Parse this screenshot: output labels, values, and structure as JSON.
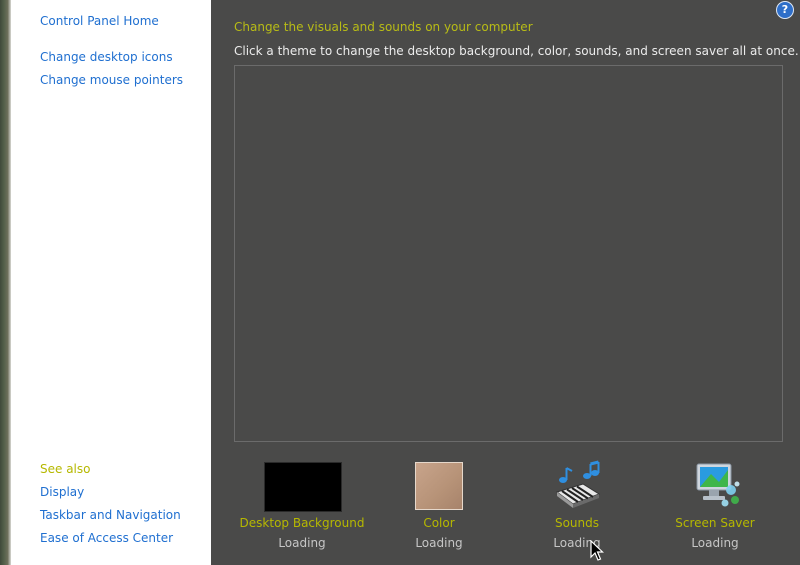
{
  "sidebar": {
    "tasks": [
      {
        "label": "Control Panel Home"
      },
      {
        "label": "Change desktop icons"
      },
      {
        "label": "Change mouse pointers"
      }
    ],
    "see_also_title": "See also",
    "see_also": [
      {
        "label": "Display"
      },
      {
        "label": "Taskbar and Navigation"
      },
      {
        "label": "Ease of Access Center"
      }
    ]
  },
  "main": {
    "help_glyph": "?",
    "headline": "Change the visuals and sounds on your computer",
    "subtitle": "Click a theme to change the desktop background, color, sounds, and screen saver all at once.",
    "tiles": [
      {
        "label": "Desktop Background",
        "status": "Loading",
        "icon": "black-swatch"
      },
      {
        "label": "Color",
        "status": "Loading",
        "icon": "tan-color-swatch"
      },
      {
        "label": "Sounds",
        "status": "Loading",
        "icon": "music-keyboard-icon"
      },
      {
        "label": "Screen Saver",
        "status": "Loading",
        "icon": "monitor-screensaver-icon"
      }
    ]
  },
  "colors": {
    "link": "#1f6fd0",
    "accent_yellow": "#b8bc16",
    "pane_bg": "#4a4a49",
    "sidebar_bg": "#ffffff"
  }
}
